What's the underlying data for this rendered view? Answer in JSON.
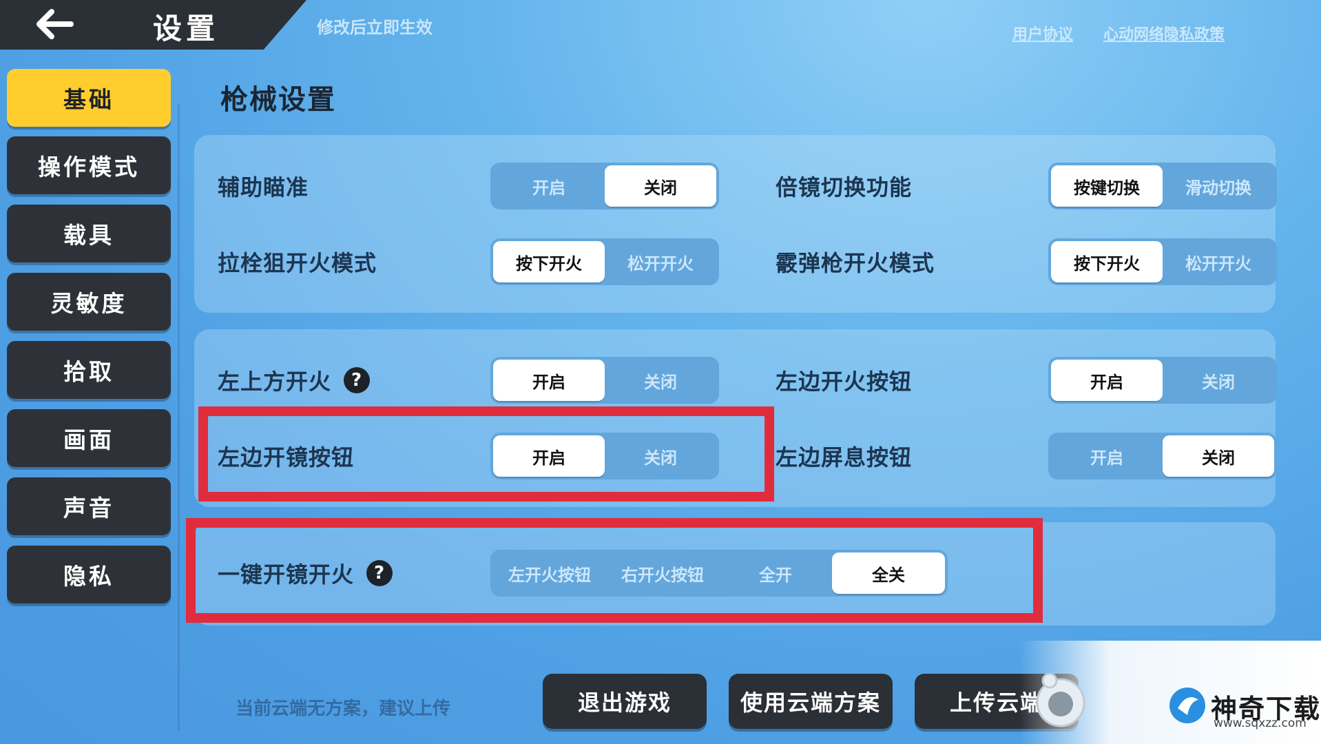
{
  "header": {
    "back_label": "",
    "title": "设置",
    "note": "修改后立即生效",
    "links": [
      "用户协议",
      "心动网络隐私政策"
    ]
  },
  "sidebar": {
    "items": [
      {
        "label": "基础",
        "active": true
      },
      {
        "label": "操作模式"
      },
      {
        "label": "载具"
      },
      {
        "label": "灵敏度"
      },
      {
        "label": "拾取"
      },
      {
        "label": "画面"
      },
      {
        "label": "声音"
      },
      {
        "label": "隐私"
      }
    ]
  },
  "main": {
    "section_title": "枪械设置",
    "rows": [
      {
        "label": "辅助瞄准",
        "options": [
          "开启",
          "关闭"
        ],
        "selected": "关闭"
      },
      {
        "label": "倍镜切换功能",
        "options": [
          "按键切换",
          "滑动切换"
        ],
        "selected": "按键切换"
      },
      {
        "label": "拉栓狙开火模式",
        "options": [
          "按下开火",
          "松开开火"
        ],
        "selected": "按下开火"
      },
      {
        "label": "霰弹枪开火模式",
        "options": [
          "按下开火",
          "松开开火"
        ],
        "selected": "按下开火"
      },
      {
        "label": "左上方开火",
        "help": "?",
        "options": [
          "开启",
          "关闭"
        ],
        "selected": "开启"
      },
      {
        "label": "左边开火按钮",
        "options": [
          "开启",
          "关闭"
        ],
        "selected": "开启"
      },
      {
        "label": "左边开镜按钮",
        "options": [
          "开启",
          "关闭"
        ],
        "selected": "开启"
      },
      {
        "label": "左边屏息按钮",
        "options": [
          "开启",
          "关闭"
        ],
        "selected": "关闭"
      },
      {
        "label": "一键开镜开火",
        "help": "?",
        "options": [
          "左开火按钮",
          "右开火按钮",
          "全开",
          "全关"
        ],
        "selected": "全关"
      }
    ]
  },
  "footer": {
    "cloud_note": "当前云端无方案，建议上传",
    "buttons": [
      "退出游戏",
      "使用云端方案",
      "上传云端"
    ]
  },
  "watermark": {
    "name": "神奇下载",
    "url": "www.sqxzz.com"
  },
  "colors": {
    "accent_yellow": "#ffcd2e",
    "dark_button": "#2b2f36",
    "highlight_red": "#e12c3c"
  }
}
